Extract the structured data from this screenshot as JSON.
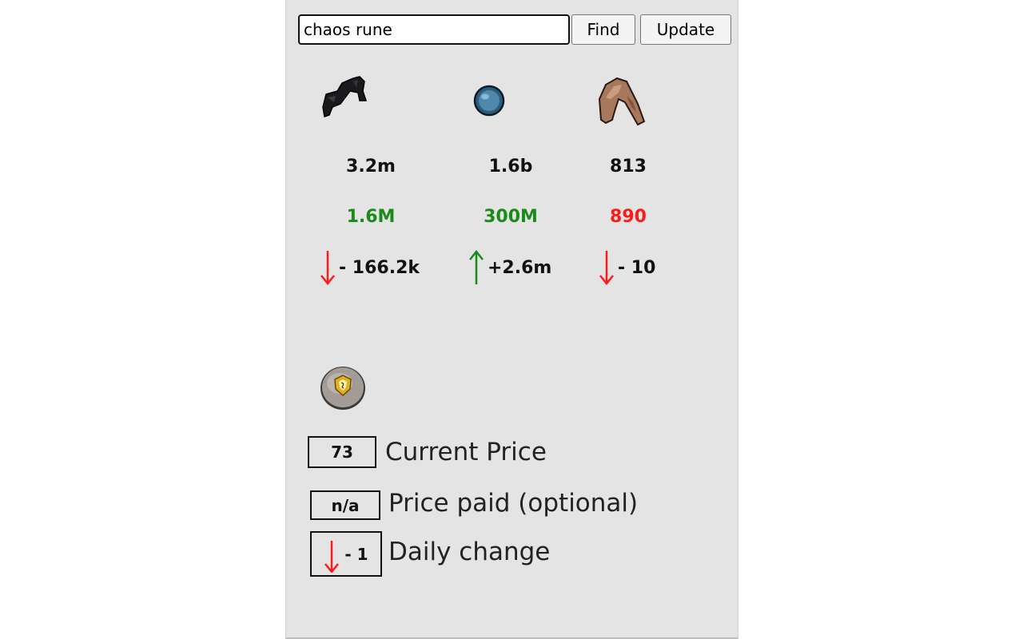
{
  "search": {
    "value": "chaos rune"
  },
  "buttons": {
    "find": "Find",
    "update": "Update"
  },
  "items": [
    {
      "icon": "dark-cape-item-icon",
      "value": "3.2m",
      "volume": "1.6M",
      "volume_color": "#1a8a1a",
      "change_direction": "down",
      "change": "- 166.2k"
    },
    {
      "icon": "blue-orb-item-icon",
      "value": "1.6b",
      "volume": "300M",
      "volume_color": "#1a8a1a",
      "change_direction": "up",
      "change": "+2.6m"
    },
    {
      "icon": "leather-item-icon",
      "value": "813",
      "volume": "890",
      "volume_color": "#ff1a1a",
      "change_direction": "down",
      "change": "- 10"
    }
  ],
  "selected": {
    "icon": "chaos-rune-icon",
    "current_price": "73",
    "current_price_label": "Current Price",
    "price_paid": "n/a",
    "price_paid_label": "Price paid (optional)",
    "daily_change_direction": "down",
    "daily_change": "- 1",
    "daily_change_label": "Daily change"
  },
  "colors": {
    "up": "#1a8a1a",
    "down": "#ff1a1a",
    "panel_bg": "#e4e4e4"
  }
}
